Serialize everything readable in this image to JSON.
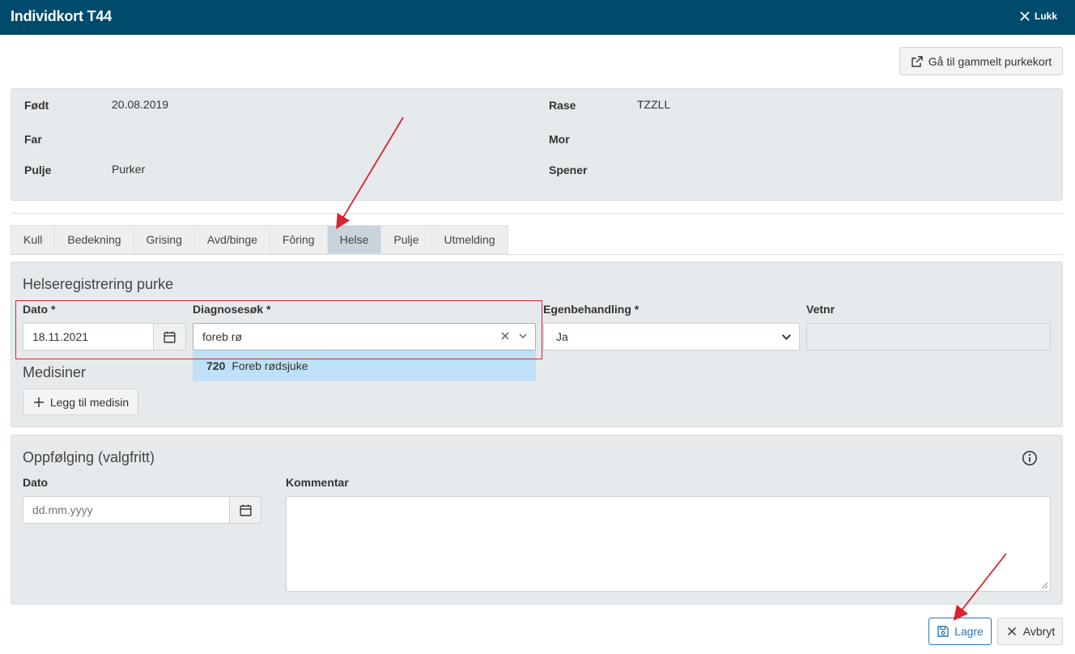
{
  "window": {
    "title": "Individkort T44",
    "close_label": "Lukk"
  },
  "toolbar": {
    "old_card_label": "Gå til gammelt purkekort"
  },
  "info": {
    "born_label": "Født",
    "born_value": "20.08.2019",
    "breed_label": "Rase",
    "breed_value": "TZZLL",
    "father_label": "Far",
    "mother_label": "Mor",
    "pool_label": "Pulje",
    "pool_value": "Purker",
    "feeder_label": "Spener"
  },
  "tabs": [
    {
      "label": "Kull"
    },
    {
      "label": "Bedekning"
    },
    {
      "label": "Grising"
    },
    {
      "label": "Avd/binge"
    },
    {
      "label": "Fôring"
    },
    {
      "label": "Helse"
    },
    {
      "label": "Pulje"
    },
    {
      "label": "Utmelding"
    }
  ],
  "active_tab": "Helse",
  "health": {
    "title": "Helseregistrering purke",
    "date_label": "Dato *",
    "date_value": "18.11.2021",
    "diagnosis_label": "Diagnosesøk *",
    "diagnosis_value": "foreb rø",
    "diagnosis_option_code": "720",
    "diagnosis_option_name": "Foreb rødsjuke",
    "self_treatment_label": "Egenbehandling *",
    "self_treatment_value": "Ja",
    "vet_label": "Vetnr",
    "vet_value": "",
    "medicines_title": "Medisiner",
    "add_medicine_label": "Legg til medisin"
  },
  "followup": {
    "title": "Oppfølging (valgfritt)",
    "date_label": "Dato",
    "date_placeholder": "dd.mm.yyyy",
    "comment_label": "Kommentar",
    "comment_value": ""
  },
  "actions": {
    "save_label": "Lagre",
    "cancel_label": "Avbryt"
  },
  "colors": {
    "titlebar": "#004b6b",
    "panel": "#e6eaed",
    "active_tab": "#c9d3db",
    "dropdown_highlight": "#bfe1f7",
    "annotation": "#d9232e",
    "save_border": "#2a77b8"
  }
}
